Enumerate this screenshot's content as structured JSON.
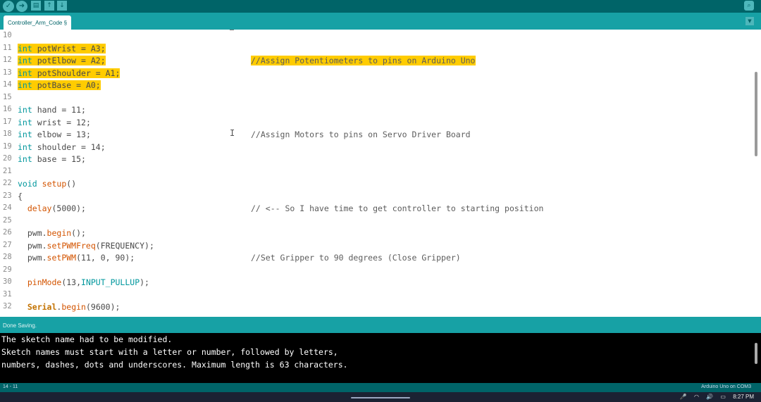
{
  "toolbar": {
    "verify_icon": "✓",
    "upload_icon": "➜",
    "new_icon": "▤",
    "open_icon": "↑",
    "save_icon": "↓",
    "serial_monitor_icon": "⌕"
  },
  "tab": {
    "label": "Controller_Arm_Code §",
    "menu_icon": "▼"
  },
  "editor": {
    "lines": [
      {
        "n": "10",
        "code": ""
      },
      {
        "n": "11",
        "code": "int potWrist = A3;",
        "highlight": true
      },
      {
        "n": "12",
        "code": "int potElbow = A2;",
        "highlight": true,
        "comment": "//Assign Potentiometers to pins on Arduino Uno"
      },
      {
        "n": "13",
        "code": "int potShoulder = A1;",
        "highlight": true
      },
      {
        "n": "14",
        "code": "int potBase = A0;",
        "highlight": true
      },
      {
        "n": "15",
        "code": ""
      },
      {
        "n": "16",
        "code": "int hand = 11;"
      },
      {
        "n": "17",
        "code": "int wrist = 12;"
      },
      {
        "n": "18",
        "code": "int elbow = 13;",
        "comment": "//Assign Motors to pins on Servo Driver Board"
      },
      {
        "n": "19",
        "code": "int shoulder = 14;"
      },
      {
        "n": "20",
        "code": "int base = 15;"
      },
      {
        "n": "21",
        "code": ""
      },
      {
        "n": "22",
        "code": "void setup()"
      },
      {
        "n": "23",
        "code": "{"
      },
      {
        "n": "24",
        "code": "  delay(5000);",
        "comment": "// <-- So I have time to get controller to starting position"
      },
      {
        "n": "25",
        "code": ""
      },
      {
        "n": "26",
        "code": "  pwm.begin();"
      },
      {
        "n": "27",
        "code": "  pwm.setPWMFreq(FREQUENCY);"
      },
      {
        "n": "28",
        "code": "  pwm.setPWM(11, 0, 90);",
        "comment": "//Set Gripper to 90 degrees (Close Gripper)"
      },
      {
        "n": "29",
        "code": ""
      },
      {
        "n": "30",
        "code": "  pinMode(13,INPUT_PULLUP);"
      },
      {
        "n": "31",
        "code": ""
      },
      {
        "n": "32",
        "code": "  Serial.begin(9600);"
      }
    ],
    "mouse_cursor": "I"
  },
  "status": {
    "text": "Done Saving."
  },
  "console": {
    "lines": [
      "The sketch name had to be modified.",
      "Sketch names must start with a letter or number, followed by letters,",
      "numbers, dashes, dots and underscores. Maximum length is 63 characters."
    ]
  },
  "footer": {
    "line_number": "14 - 11",
    "board": "Arduino Uno on COM3"
  },
  "taskbar": {
    "mic_icon": "🎤",
    "wifi_icon": "◠",
    "volume_icon": "🔊",
    "battery_icon": "▭",
    "time": "8:27 PM"
  },
  "colors": {
    "teal_dark": "#006468",
    "teal": "#17a1a5",
    "highlight": "#ffcc00"
  }
}
